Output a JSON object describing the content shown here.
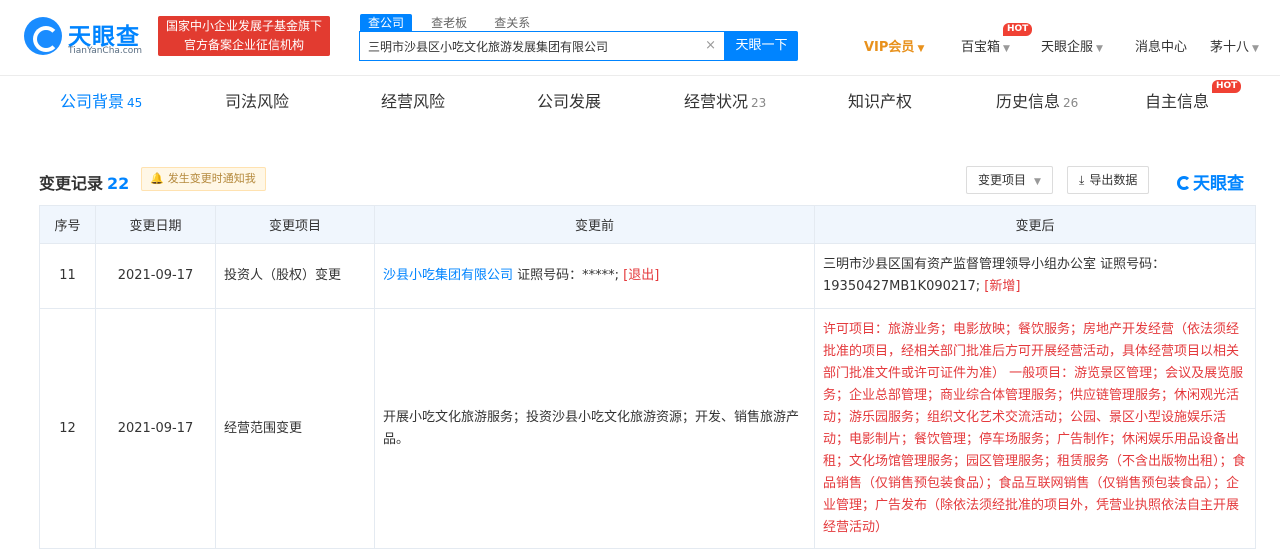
{
  "header": {
    "logo_text": "天眼查",
    "logo_sub": "TianYanCha.com",
    "badge_line1": "国家中小企业发展子基金旗下",
    "badge_line2": "官方备案企业征信机构",
    "search_tabs": [
      "查公司",
      "查老板",
      "查关系"
    ],
    "search_value": "三明市沙县区小吃文化旅游发展集团有限公司",
    "search_clear": "×",
    "search_button": "天眼一下",
    "vip": "VIP会员",
    "nav": [
      "百宝箱",
      "天眼企服",
      "消息中心",
      "茅十八"
    ],
    "hot_label": "HOT"
  },
  "tabs": [
    {
      "label": "公司背景",
      "count": "45"
    },
    {
      "label": "司法风险",
      "count": ""
    },
    {
      "label": "经营风险",
      "count": ""
    },
    {
      "label": "公司发展",
      "count": ""
    },
    {
      "label": "经营状况",
      "count": "23"
    },
    {
      "label": "知识产权",
      "count": ""
    },
    {
      "label": "历史信息",
      "count": "26"
    },
    {
      "label": "自主信息",
      "count": ""
    }
  ],
  "section": {
    "title": "变更记录",
    "count": "22",
    "notify": "发生变更时通知我",
    "filter_button": "变更项目",
    "export_button": "导出数据",
    "brand": "天眼查"
  },
  "table": {
    "headers": [
      "序号",
      "变更日期",
      "变更项目",
      "变更前",
      "变更后"
    ],
    "rows": [
      {
        "index": "11",
        "date": "2021-09-17",
        "item": "投资人（股权）变更",
        "before_link": "沙县小吃集团有限公司",
        "before_rest": " 证照号码：*****; ",
        "before_tag": "[退出]",
        "after_main": "三明市沙县区国有资产监督管理领导小组办公室 证照号码：19350427MB1K090217; ",
        "after_tag": "[新增]"
      },
      {
        "index": "12",
        "date": "2021-09-17",
        "item": "经营范围变更",
        "before_text": "开展小吃文化旅游服务；投资沙县小吃文化旅游资源；开发、销售旅游产品。",
        "after_text": "许可项目：旅游业务；电影放映；餐饮服务；房地产开发经营（依法须经批准的项目，经相关部门批准后方可开展经营活动，具体经营项目以相关部门批准文件或许可证件为准） 一般项目：游览景区管理；会议及展览服务；企业总部管理；商业综合体管理服务；供应链管理服务；休闲观光活动；游乐园服务；组织文化艺术交流活动；公园、景区小型设施娱乐活动；电影制片；餐饮管理；停车场服务；广告制作；休闲娱乐用品设备出租；文化场馆管理服务；园区管理服务；租赁服务（不含出版物出租）；食品销售（仅销售预包装食品）；食品互联网销售（仅销售预包装食品）；企业管理；广告发布（除依法须经批准的项目外，凭营业执照依法自主开展经营活动）"
      }
    ]
  },
  "colors": {
    "brand_blue": "#0084ff",
    "badge_red": "#e23b30",
    "change_red": "#e4393c",
    "vip_orange": "#e8911c"
  }
}
